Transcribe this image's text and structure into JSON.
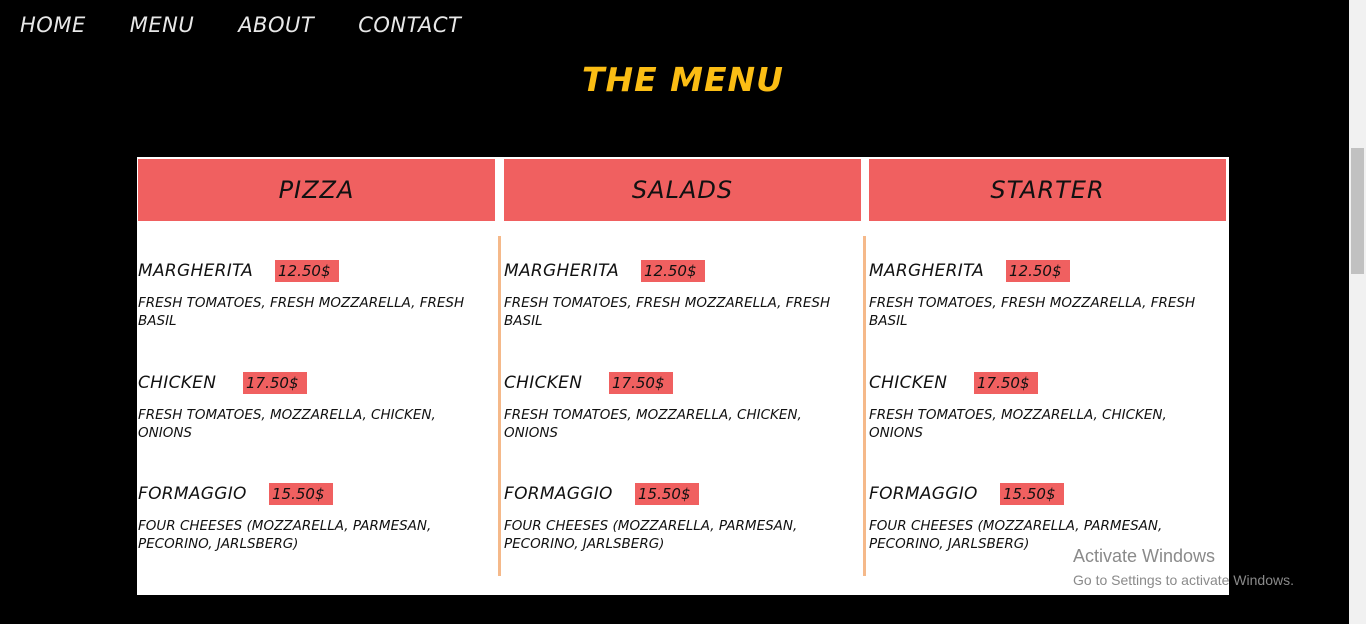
{
  "nav": {
    "items": [
      "HOME",
      "MENU",
      "ABOUT",
      "CONTACT"
    ]
  },
  "page_title": "THE MENU",
  "categories": [
    {
      "name": "PIZZA",
      "items": [
        {
          "name": "MARGHERITA",
          "price": "12.50$",
          "desc": "FRESH TOMATOES, FRESH MOZZARELLA, FRESH BASIL"
        },
        {
          "name": "CHICKEN",
          "price": "17.50$",
          "desc": "FRESH TOMATOES, MOZZARELLA, CHICKEN, ONIONS"
        },
        {
          "name": "FORMAGGIO",
          "price": "15.50$",
          "desc": "FOUR CHEESES (MOZZARELLA, PARMESAN, PECORINO, JARLSBERG)"
        }
      ]
    },
    {
      "name": "SALADS",
      "items": [
        {
          "name": "MARGHERITA",
          "price": "12.50$",
          "desc": "FRESH TOMATOES, FRESH MOZZARELLA, FRESH BASIL"
        },
        {
          "name": "CHICKEN",
          "price": "17.50$",
          "desc": "FRESH TOMATOES, MOZZARELLA, CHICKEN, ONIONS"
        },
        {
          "name": "FORMAGGIO",
          "price": "15.50$",
          "desc": "FOUR CHEESES (MOZZARELLA, PARMESAN, PECORINO, JARLSBERG)"
        }
      ]
    },
    {
      "name": "STARTER",
      "items": [
        {
          "name": "MARGHERITA",
          "price": "12.50$",
          "desc": "FRESH TOMATOES, FRESH MOZZARELLA, FRESH BASIL"
        },
        {
          "name": "CHICKEN",
          "price": "17.50$",
          "desc": "FRESH TOMATOES, MOZZARELLA, CHICKEN, ONIONS"
        },
        {
          "name": "FORMAGGIO",
          "price": "15.50$",
          "desc": "FOUR CHEESES (MOZZARELLA, PARMESAN, PECORINO, JARLSBERG)"
        }
      ]
    }
  ],
  "watermark": {
    "title": "Activate Windows",
    "subtitle": "Go to Settings to activate Windows."
  },
  "colors": {
    "accent": "#fbbd14",
    "header_bg": "#f06060",
    "divider": "#f5b98a",
    "page_bg": "#000000"
  }
}
